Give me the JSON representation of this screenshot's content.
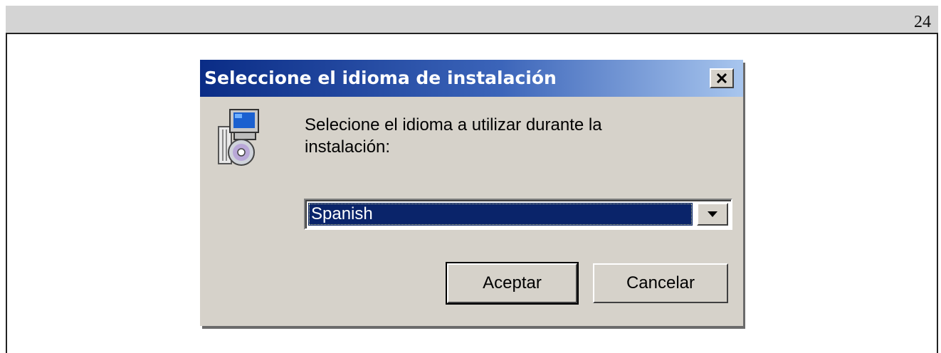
{
  "page": {
    "number": "24"
  },
  "dialog": {
    "title": "Seleccione el idioma de instalación",
    "prompt": "Selecione el idioma a utilizar durante la instalación:",
    "language": {
      "selected": "Spanish"
    },
    "buttons": {
      "ok": "Aceptar",
      "cancel": "Cancelar"
    },
    "icons": {
      "app": "setup-computer-cd-icon",
      "close": "close-icon",
      "dropdown": "chevron-down-icon"
    }
  },
  "colors": {
    "title_gradient_start": "#0a2c86",
    "title_gradient_end": "#a8c6ee",
    "dialog_face": "#d6d2ca",
    "selection": "#0a246a"
  }
}
